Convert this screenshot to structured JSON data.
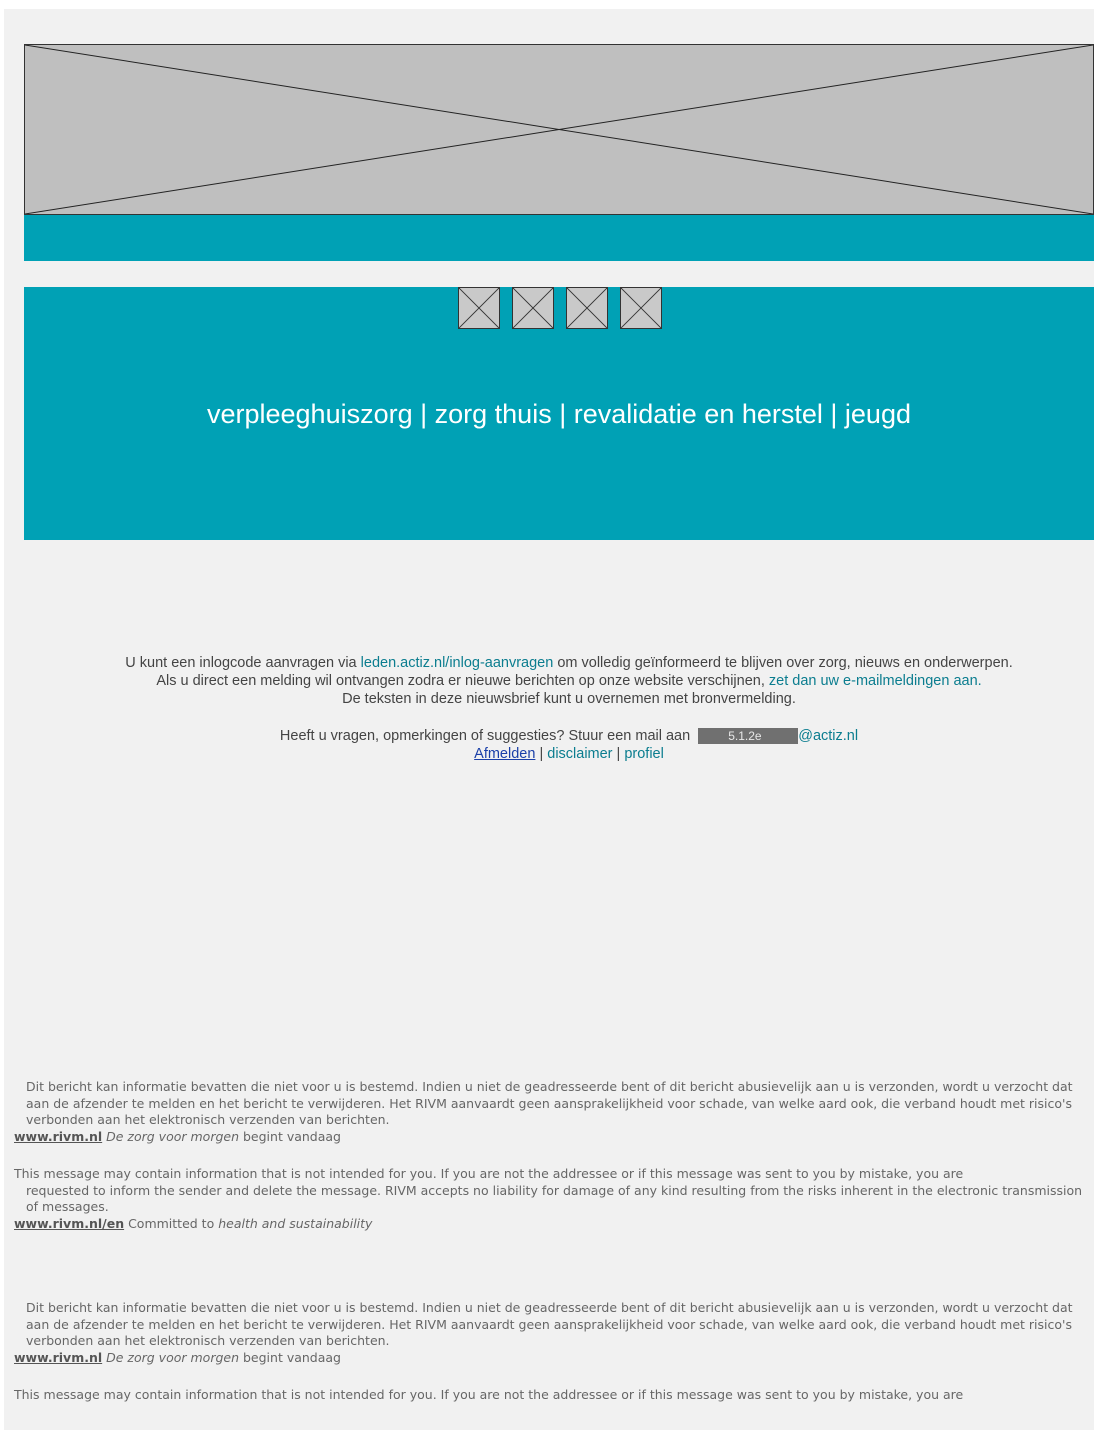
{
  "nav": {
    "items": [
      "verpleeghuiszorg",
      "zorg thuis",
      "revalidatie en herstel",
      "jeugd"
    ],
    "separator": " | "
  },
  "info": {
    "line1_pre": "U kunt een inlogcode aanvragen via ",
    "line1_link": "leden.actiz.nl/inlog-aanvragen",
    "line1_post": " om volledig geïnformeerd te blijven over zorg, nieuws en onderwerpen.",
    "line2_pre": "Als u direct een melding wil ontvangen zodra er nieuwe berichten op onze website verschijnen, ",
    "line2_link": "zet dan uw e-mailmeldingen aan.",
    "line3": "De teksten in deze nieuwsbrief kunt u overnemen met bronvermelding.",
    "contact_pre": "Heeft u vragen, opmerkingen of suggesties? Stuur een mail aan ",
    "redacted": "5.1.2e",
    "contact_domain": "@actiz.nl",
    "unsubscribe": "Afmelden",
    "disclaimer": "disclaimer",
    "profile": "profiel",
    "sep": " | "
  },
  "disclaimer_nl": {
    "text": "Dit bericht kan informatie bevatten die niet voor u is bestemd. Indien u niet de geadresseerde bent of dit bericht abusievelijk aan u is verzonden, wordt u verzocht dat aan de afzender te melden en het bericht te verwijderen. Het RIVM aanvaardt geen aansprakelijkheid voor schade, van welke aard ook, die verband houdt met risico's verbonden aan het elektronisch verzenden van berichten.",
    "site": "www.rivm.nl",
    "tagline_italic": "De zorg voor morgen",
    "tagline_rest": " begint vandaag"
  },
  "disclaimer_en": {
    "text_first": "This message may contain information that is not intended for you. If you are not the addressee or if this message was sent to you by mistake, you are",
    "text_rest": "requested to inform the sender and delete the message. RIVM accepts no liability for damage of any kind resulting from the risks inherent in the electronic transmission of messages.",
    "site": "www.rivm.nl/en",
    "tagline_pre": " Committed to ",
    "tagline_italic": "health and sustainability"
  }
}
